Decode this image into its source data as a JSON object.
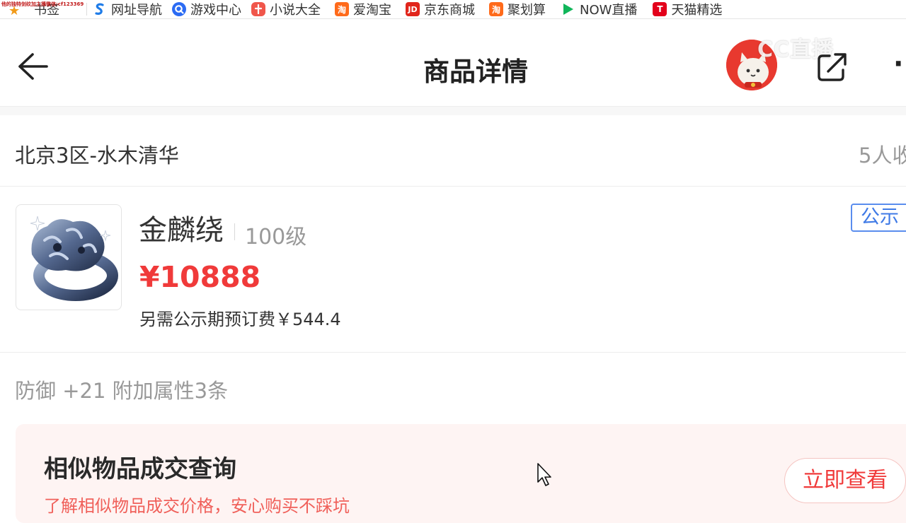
{
  "bookmarks": {
    "tiny_text": "他的独特剑纹加主播微信:cf123369",
    "items": [
      {
        "label": "书签",
        "icon": "star-icon"
      },
      {
        "label": "网址导航",
        "icon": "sogou-icon",
        "color": "#1f7ce8"
      },
      {
        "label": "游戏中心",
        "icon": "game-center-icon",
        "color": "#2b6bf3"
      },
      {
        "label": "小说大全",
        "icon": "novel-icon",
        "color": "#f0564b"
      },
      {
        "label": "爱淘宝",
        "icon": "taobao-icon",
        "color": "#ff6a1a",
        "glyph": "淘"
      },
      {
        "label": "京东商城",
        "icon": "jd-icon",
        "color": "#e1251b",
        "glyph": "JD"
      },
      {
        "label": "聚划算",
        "icon": "juhuasuan-icon",
        "color": "#ff6a1a",
        "glyph": "淘"
      },
      {
        "label": "NOW直播",
        "icon": "now-live-icon",
        "color": "#11b65a"
      },
      {
        "label": "天猫精选",
        "icon": "tmall-icon",
        "color": "#e3001b",
        "glyph": "T"
      }
    ]
  },
  "header": {
    "title": "商品详情",
    "watermark": "CC直播"
  },
  "server": {
    "name": "北京3区-水木清华",
    "collect_count": "5人收"
  },
  "item": {
    "name": "金麟绕",
    "level": "100级",
    "price": "¥10888",
    "fee": "另需公示期预订费￥544.4",
    "status_tag": "公示"
  },
  "attributes": {
    "text": "防御 +21 附加属性3条"
  },
  "similar": {
    "title": "相似物品成交查询",
    "desc": "了解相似物品成交价格，安心购买不踩坑",
    "button": "立即查看"
  },
  "colors": {
    "price_red": "#f03a3a",
    "tag_blue": "#3f7ae6",
    "similar_bg": "#fef4f3"
  }
}
